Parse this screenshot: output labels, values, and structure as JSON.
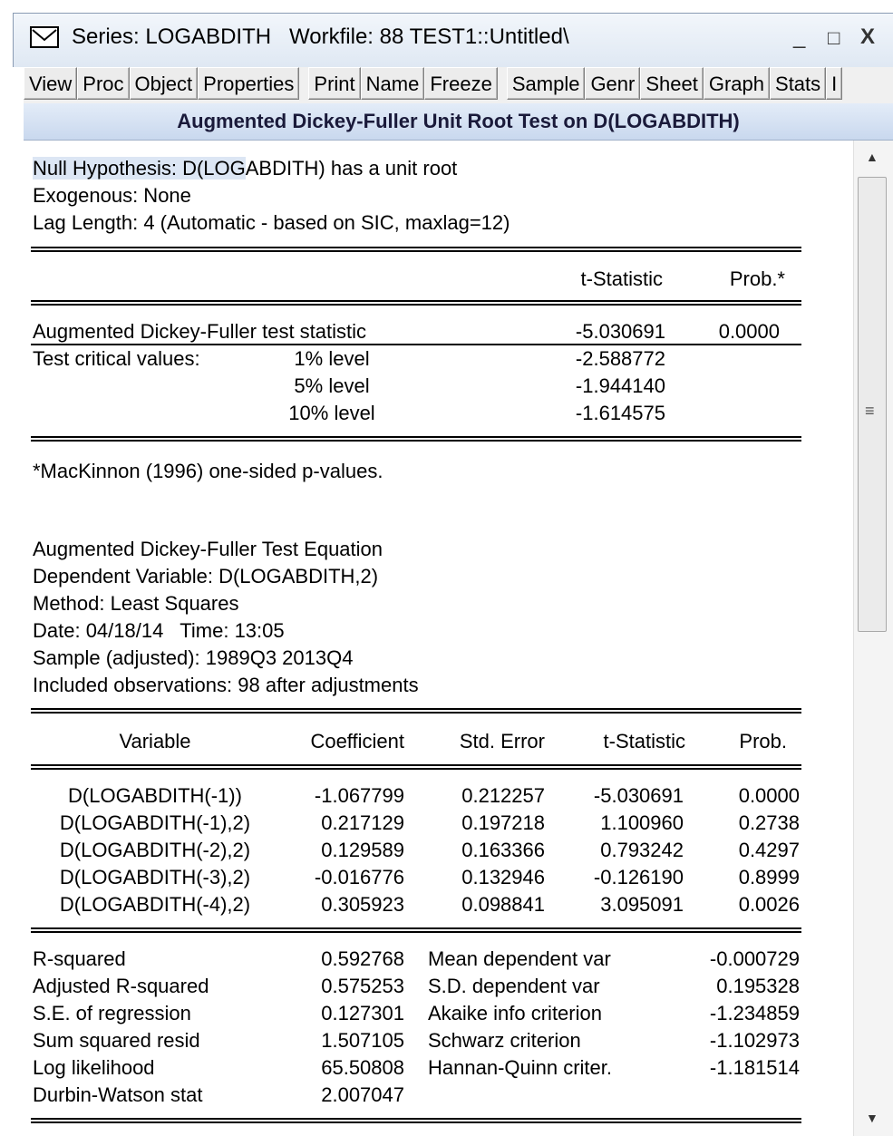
{
  "window": {
    "title": "Series: LOGABDITH   Workfile: 88 TEST1::Untitled\\",
    "minimize": "_",
    "maximize": "□",
    "close": "X"
  },
  "toolbar": [
    "View",
    "Proc",
    "Object",
    "Properties",
    "Print",
    "Name",
    "Freeze",
    "Sample",
    "Genr",
    "Sheet",
    "Graph",
    "Stats",
    "I"
  ],
  "heading": "Augmented Dickey-Fuller Unit Root Test on D(LOGABDITH)",
  "header": {
    "null_hypothesis_a": "Null Hypothesis: D(LOG",
    "null_hypothesis_b": "ABDITH) has a unit root",
    "exogenous": "Exogenous: None",
    "lag_length": "Lag Length: 4 (Automatic - based on SIC, maxlag=12)"
  },
  "test_table": {
    "col_tstat": "t-Statistic",
    "col_prob": "Prob.*",
    "adf_label": "Augmented Dickey-Fuller test statistic",
    "adf_tstat": "-5.030691",
    "adf_prob": "0.0000",
    "critical_label": "Test critical values:",
    "levels": [
      {
        "level": "1% level",
        "value": "-2.588772"
      },
      {
        "level": "5% level",
        "value": "-1.944140"
      },
      {
        "level": "10% level",
        "value": "-1.614575"
      }
    ]
  },
  "footnote": "*MacKinnon (1996) one-sided p-values.",
  "equation_info": {
    "title": "Augmented Dickey-Fuller Test Equation",
    "dependent": "Dependent Variable: D(LOGABDITH,2)",
    "method": "Method: Least Squares",
    "date": "Date: 04/18/14   Time: 13:05",
    "sample": "Sample (adjusted): 1989Q3 2013Q4",
    "observations": "Included observations: 98 after adjustments"
  },
  "coef_table": {
    "headers": [
      "Variable",
      "Coefficient",
      "Std. Error",
      "t-Statistic",
      "Prob."
    ],
    "rows": [
      [
        "D(LOGABDITH(-1))",
        "-1.067799",
        "0.212257",
        "-5.030691",
        "0.0000"
      ],
      [
        "D(LOGABDITH(-1),2)",
        "0.217129",
        "0.197218",
        "1.100960",
        "0.2738"
      ],
      [
        "D(LOGABDITH(-2),2)",
        "0.129589",
        "0.163366",
        "0.793242",
        "0.4297"
      ],
      [
        "D(LOGABDITH(-3),2)",
        "-0.016776",
        "0.132946",
        "-0.126190",
        "0.8999"
      ],
      [
        "D(LOGABDITH(-4),2)",
        "0.305923",
        "0.098841",
        "3.095091",
        "0.0026"
      ]
    ]
  },
  "stats": {
    "left": [
      [
        "R-squared",
        "0.592768"
      ],
      [
        "Adjusted R-squared",
        "0.575253"
      ],
      [
        "S.E. of regression",
        "0.127301"
      ],
      [
        "Sum squared resid",
        "1.507105"
      ],
      [
        "Log likelihood",
        "65.50808"
      ],
      [
        "Durbin-Watson stat",
        "2.007047"
      ]
    ],
    "right": [
      [
        "Mean dependent var",
        "-0.000729"
      ],
      [
        "S.D. dependent var",
        "0.195328"
      ],
      [
        "Akaike info criterion",
        "-1.234859"
      ],
      [
        "Schwarz criterion",
        "-1.102973"
      ],
      [
        "Hannan-Quinn criter.",
        "-1.181514"
      ]
    ]
  }
}
